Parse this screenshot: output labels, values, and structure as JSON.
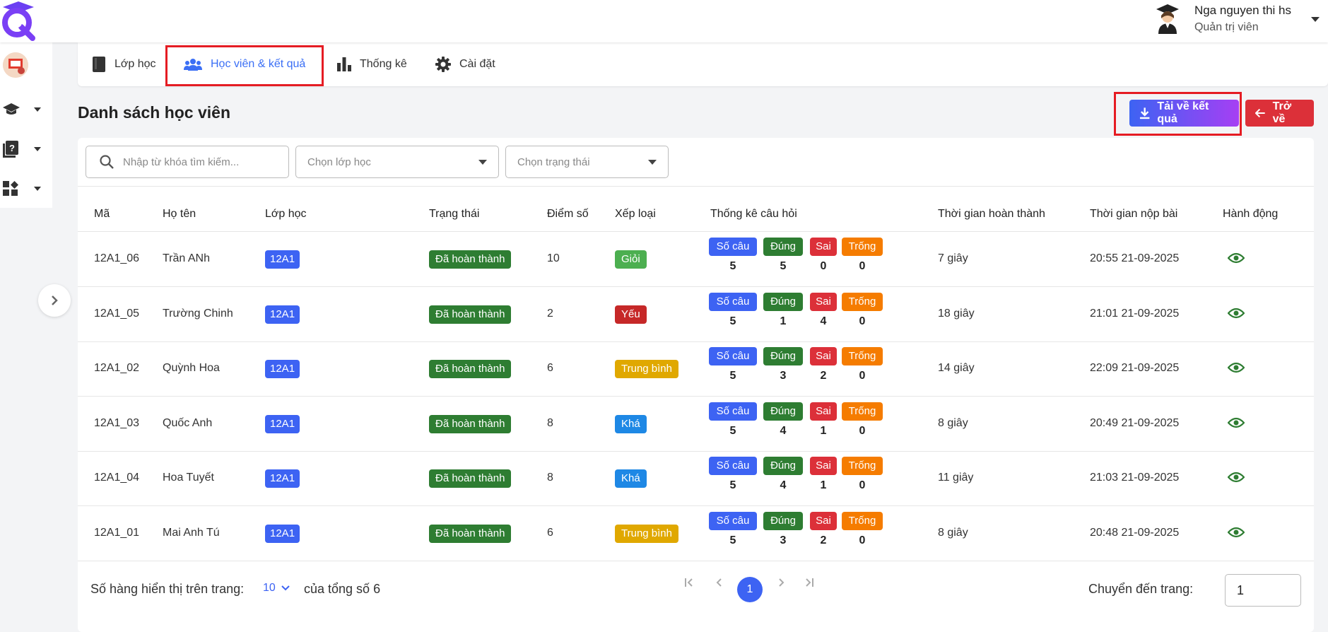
{
  "header": {
    "user_name": "Nga nguyen thi hs",
    "user_role": "Quản trị viên"
  },
  "tabs": [
    {
      "label": "Lớp học",
      "icon": "book-icon"
    },
    {
      "label": "Học viên & kết quả",
      "icon": "people-icon",
      "active": true
    },
    {
      "label": "Thống kê",
      "icon": "bar-chart-icon"
    },
    {
      "label": "Cài đặt",
      "icon": "gear-icon"
    }
  ],
  "page": {
    "title": "Danh sách học viên",
    "download_label": "Tải về kết quả",
    "back_label": "Trở về"
  },
  "filters": {
    "search_placeholder": "Nhập từ khóa tìm kiếm...",
    "class_placeholder": "Chọn lớp học",
    "status_placeholder": "Chọn trạng thái"
  },
  "table": {
    "headers": [
      "Mã",
      "Họ tên",
      "Lớp học",
      "Trạng thái",
      "Điểm số",
      "Xếp loại",
      "Thống kê câu hỏi",
      "Thời gian hoàn thành",
      "Thời gian nộp bài",
      "Hành động"
    ],
    "stat_labels": [
      "Số câu",
      "Đúng",
      "Sai",
      "Trống"
    ],
    "rows": [
      {
        "code": "12A1_06",
        "name": "Trần ANh",
        "class": "12A1",
        "status": "Đã hoàn thành",
        "score": "10",
        "rank": "Giỏi",
        "rank_color": "#4caf50",
        "total": "5",
        "correct": "5",
        "wrong": "0",
        "empty": "0",
        "duration": "7 giây",
        "submitted": "20:55 21-09-2025"
      },
      {
        "code": "12A1_05",
        "name": "Trường Chinh",
        "class": "12A1",
        "status": "Đã hoàn thành",
        "score": "2",
        "rank": "Yếu",
        "rank_color": "#c62828",
        "total": "5",
        "correct": "1",
        "wrong": "4",
        "empty": "0",
        "duration": "18 giây",
        "submitted": "21:01 21-09-2025"
      },
      {
        "code": "12A1_02",
        "name": "Quỳnh Hoa",
        "class": "12A1",
        "status": "Đã hoàn thành",
        "score": "6",
        "rank": "Trung bình",
        "rank_color": "#e0a800",
        "total": "5",
        "correct": "3",
        "wrong": "2",
        "empty": "0",
        "duration": "14 giây",
        "submitted": "22:09 21-09-2025"
      },
      {
        "code": "12A1_03",
        "name": "Quốc Anh",
        "class": "12A1",
        "status": "Đã hoàn thành",
        "score": "8",
        "rank": "Khá",
        "rank_color": "#1e88e5",
        "total": "5",
        "correct": "4",
        "wrong": "1",
        "empty": "0",
        "duration": "8 giây",
        "submitted": "20:49 21-09-2025"
      },
      {
        "code": "12A1_04",
        "name": "Hoa Tuyết",
        "class": "12A1",
        "status": "Đã hoàn thành",
        "score": "8",
        "rank": "Khá",
        "rank_color": "#1e88e5",
        "total": "5",
        "correct": "4",
        "wrong": "1",
        "empty": "0",
        "duration": "11 giây",
        "submitted": "21:03 21-09-2025"
      },
      {
        "code": "12A1_01",
        "name": "Mai Anh Tú",
        "class": "12A1",
        "status": "Đã hoàn thành",
        "score": "6",
        "rank": "Trung bình",
        "rank_color": "#e0a800",
        "total": "5",
        "correct": "3",
        "wrong": "2",
        "empty": "0",
        "duration": "8 giây",
        "submitted": "20:48 21-09-2025"
      }
    ]
  },
  "footer": {
    "rows_per_page_label": "Số hàng hiển thị trên trang:",
    "rows_per_page_value": "10",
    "total_label": "của tổng số 6",
    "current_page": "1",
    "jump_label": "Chuyển đến trang:",
    "jump_value": "1"
  },
  "colors": {
    "primary": "#3d63f3",
    "danger": "#dc3039",
    "success": "#2e7d32",
    "highlight": "#e51c23",
    "stat_total": "#3d63f3",
    "stat_correct": "#2e7d32",
    "stat_wrong": "#dc3039",
    "stat_empty": "#f57c00"
  }
}
